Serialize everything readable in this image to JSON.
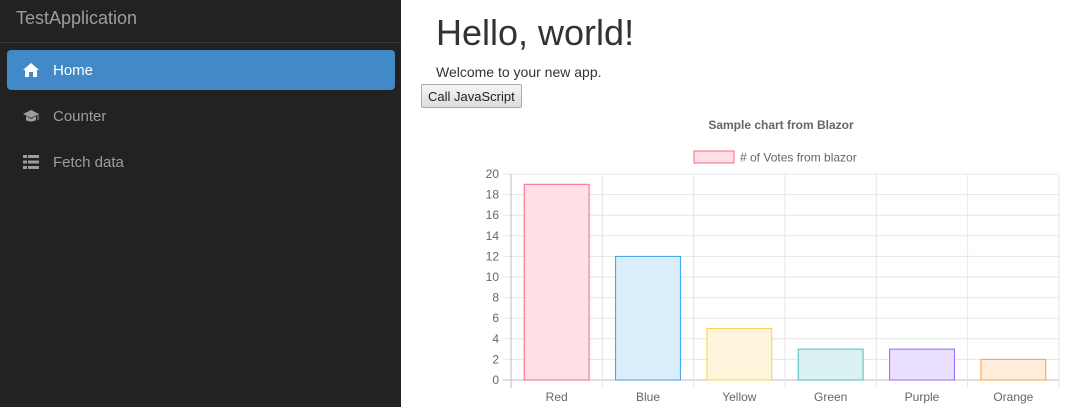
{
  "app": {
    "brand": "TestApplication"
  },
  "sidebar": {
    "items": [
      {
        "label": "Home",
        "icon": "home-icon",
        "active": true
      },
      {
        "label": "Counter",
        "icon": "graduation-cap-icon",
        "active": false
      },
      {
        "label": "Fetch data",
        "icon": "list-icon",
        "active": false
      }
    ]
  },
  "main": {
    "title": "Hello, world!",
    "welcome": "Welcome to your new app.",
    "button_label": "Call JavaScript"
  },
  "colors": {
    "sidebar_bg": "#222222",
    "active_item": "#4189c7",
    "text_muted": "#9d9d9d"
  },
  "chart_data": {
    "type": "bar",
    "title": "Sample chart from Blazor",
    "legend": "# of Votes from blazor",
    "legend_position": "top",
    "categories": [
      "Red",
      "Blue",
      "Yellow",
      "Green",
      "Purple",
      "Orange"
    ],
    "series": [
      {
        "name": "# of Votes from blazor",
        "values": [
          19,
          12,
          5,
          3,
          3,
          2
        ]
      }
    ],
    "ylim": [
      0,
      20
    ],
    "yticks": [
      "0",
      "2",
      "4",
      "6",
      "8",
      "10",
      "12",
      "14",
      "16",
      "18",
      "20"
    ],
    "grid": true,
    "fill_colors": [
      "#ffe0e6",
      "#dbeefb",
      "#fff5dd",
      "#dbf2f2",
      "#ebe0ff",
      "#ffecd9"
    ],
    "border_colors": [
      "#ff6384",
      "#36a2eb",
      "#ffce56",
      "#4bc0c0",
      "#9966ff",
      "#ff9f40"
    ]
  }
}
